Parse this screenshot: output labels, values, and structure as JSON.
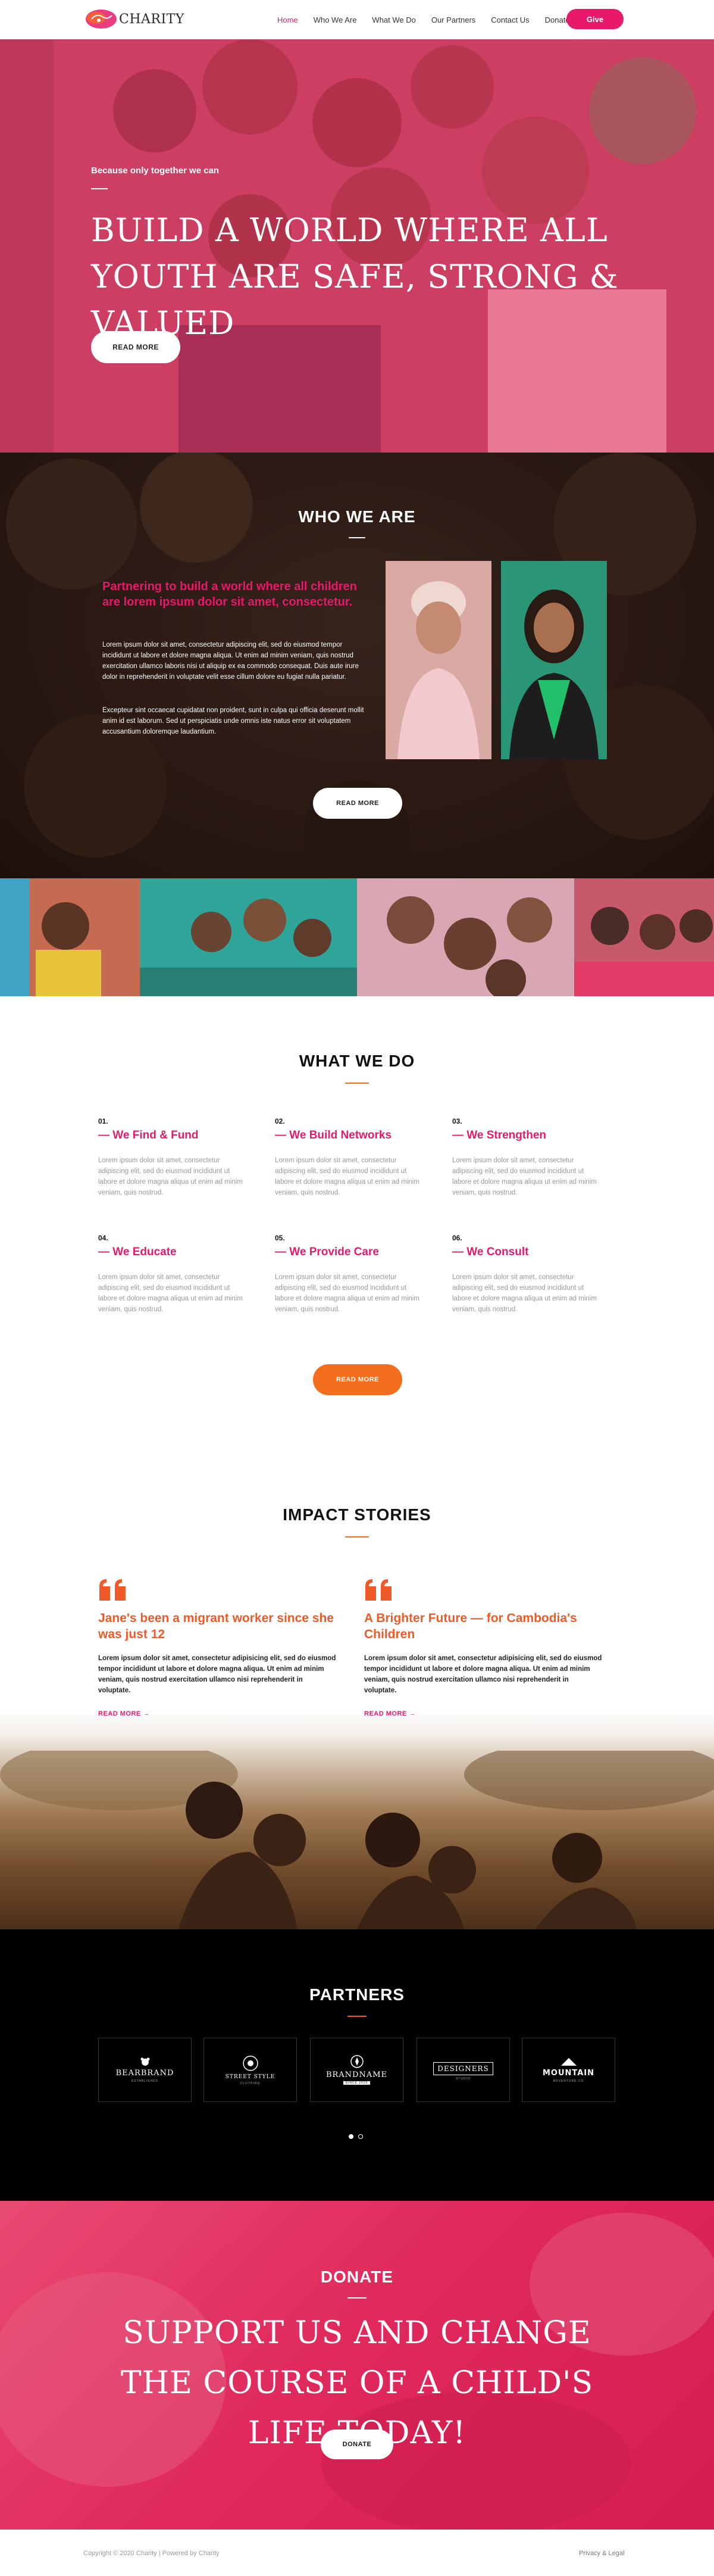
{
  "nav": {
    "logo_text": "CHARITY",
    "items": [
      {
        "label": "Home",
        "active": true
      },
      {
        "label": "Who We Are",
        "active": false
      },
      {
        "label": "What We Do",
        "active": false
      },
      {
        "label": "Our Partners",
        "active": false
      },
      {
        "label": "Contact Us",
        "active": false
      },
      {
        "label": "Donate",
        "active": false
      }
    ],
    "give_label": "Give"
  },
  "hero": {
    "subtitle": "Because only together we can",
    "title": "BUILD A WORLD WHERE ALL YOUTH ARE SAFE, STRONG & VALUED",
    "button": "READ MORE"
  },
  "who": {
    "title": "WHO WE ARE",
    "lead": "Partnering to build a world where all children are lorem ipsum dolor sit amet, consectetur.",
    "p1": "Lorem ipsum dolor sit amet, consectetur adipiscing elit, sed do eiusmod tempor incididunt ut labore et dolore magna aliqua. Ut enim ad minim veniam, quis nostrud exercitation ullamco laboris nisi ut aliquip ex ea commodo consequat. Duis aute irure dolor in reprehenderit in voluptate velit esse cillum dolore eu fugiat nulla pariatur.",
    "p2": "Excepteur sint occaecat cupidatat non proident, sunt in culpa qui officia deserunt mollit anim id est laborum. Sed ut perspiciatis unde omnis iste natus error sit voluptatem accusantium doloremque laudantium.",
    "button": "READ MORE"
  },
  "what_we_do": {
    "title": "WHAT WE DO",
    "services": [
      {
        "num": "01.",
        "title": "— We Find & Fund",
        "text": "Lorem ipsum dolor sit amet, consectetur adipiscing elit, sed do eiusmod incididunt ut labore et dolore magna aliqua ut enim ad minim veniam, quis nostrud."
      },
      {
        "num": "02.",
        "title": "— We Build Networks",
        "text": "Lorem ipsum dolor sit amet, consectetur adipiscing elit, sed do eiusmod incididunt ut labore et dolore magna aliqua ut enim ad minim veniam, quis nostrud."
      },
      {
        "num": "03.",
        "title": "— We Strengthen",
        "text": "Lorem ipsum dolor sit amet, consectetur adipiscing elit, sed do eiusmod incididunt ut labore et dolore magna aliqua ut enim ad minim veniam, quis nostrud."
      },
      {
        "num": "04.",
        "title": "— We Educate",
        "text": "Lorem ipsum dolor sit amet, consectetur adipiscing elit, sed do eiusmod incididunt ut labore et dolore magna aliqua ut enim ad minim veniam, quis nostrud."
      },
      {
        "num": "05.",
        "title": "— We Provide Care",
        "text": "Lorem ipsum dolor sit amet, consectetur adipiscing elit, sed do eiusmod incididunt ut labore et dolore magna aliqua ut enim ad minim veniam, quis nostrud."
      },
      {
        "num": "06.",
        "title": "— We Consult",
        "text": "Lorem ipsum dolor sit amet, consectetur adipiscing elit, sed do eiusmod incididunt ut labore et dolore magna aliqua ut enim ad minim veniam, quis nostrud."
      }
    ],
    "button": "READ MORE"
  },
  "impact": {
    "title": "IMPACT STORIES",
    "stories": [
      {
        "title": "Jane's been a migrant worker since she was just 12",
        "text": "Lorem ipsum dolor sit amet, consectetur adipisicing elit, sed do eiusmod tempor incididunt ut labore et dolore magna aliqua. Ut enim ad minim veniam, quis nostrud exercitation ullamco nisi reprehenderit in voluptate.",
        "link": "READ MORE →"
      },
      {
        "title": "A Brighter Future — for Cambodia's Children",
        "text": "Lorem ipsum dolor sit amet, consectetur adipisicing elit, sed do eiusmod tempor incididunt ut labore et dolore magna aliqua. Ut enim ad minim veniam, quis nostrud exercitation ullamco nisi reprehenderit in voluptate.",
        "link": "READ MORE →"
      }
    ]
  },
  "partners": {
    "title": "PARTNERS",
    "logos": [
      {
        "name": "BEARBRAND",
        "sub": "ESTABLISHED"
      },
      {
        "name": "STREET STYLE",
        "sub": "CLOTHING"
      },
      {
        "name": "BRANDNAME",
        "sub": "SINCE 2020"
      },
      {
        "name": "DESIGNERS",
        "sub": "STUDIO"
      },
      {
        "name": "MOUNTAIN",
        "sub": "ADVENTURE CO"
      }
    ]
  },
  "donate": {
    "title": "DONATE",
    "headline": "SUPPORT US AND CHANGE THE COURSE OF A CHILD'S LIFE TODAY!",
    "button": "DONATE"
  },
  "footer": {
    "copyright": "Copyright © 2020 Charity | Powered by Charity",
    "legal": "Privacy & Legal"
  },
  "colors": {
    "brand_pink": "#e8196b",
    "accent_orange": "#f36f1e",
    "story_orange": "#f05a28"
  }
}
